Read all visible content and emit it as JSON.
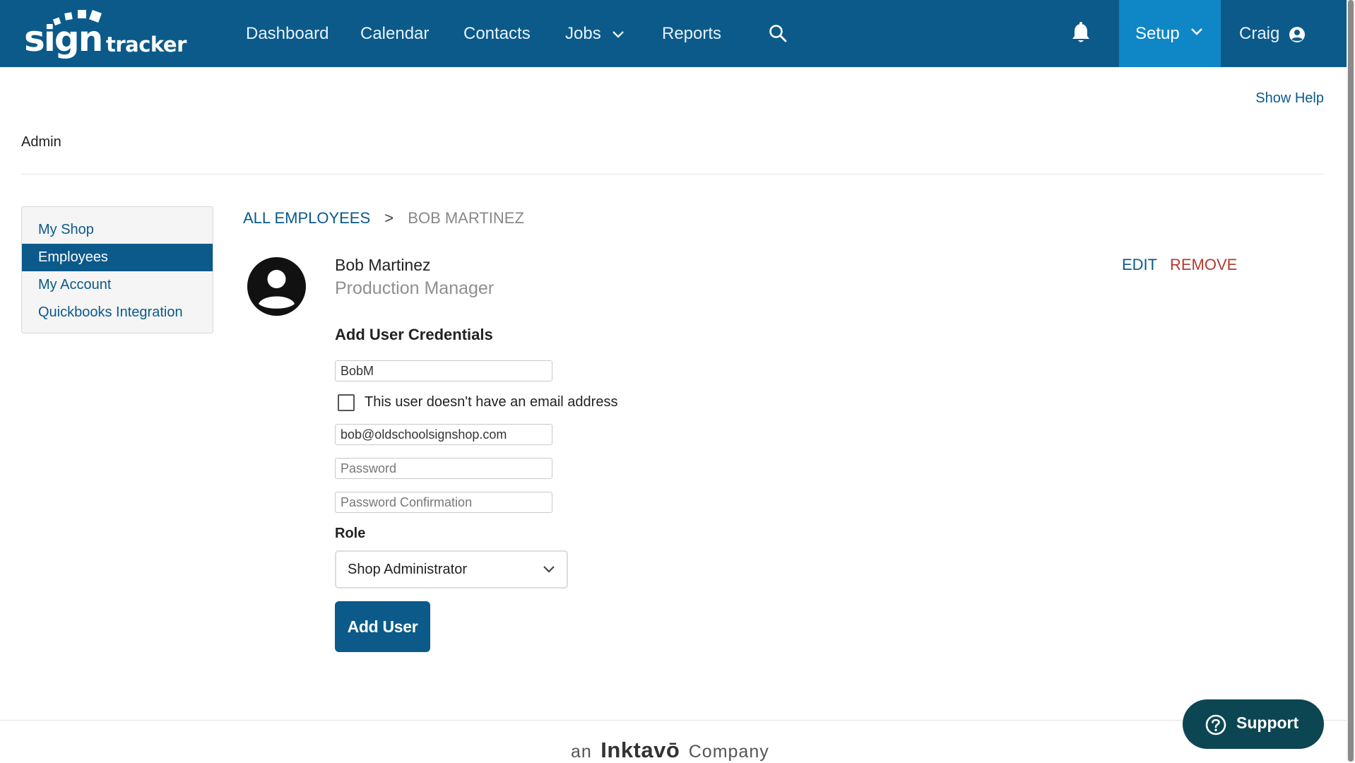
{
  "brand": {
    "logo_sign": "sign",
    "logo_tracker": "tracker",
    "logo_reg": "®"
  },
  "nav": {
    "items": [
      {
        "label": "Dashboard"
      },
      {
        "label": "Calendar"
      },
      {
        "label": "Contacts"
      },
      {
        "label": "Jobs",
        "has_dropdown": true
      },
      {
        "label": "Reports"
      }
    ],
    "search_icon": "search-icon",
    "notification_icon": "bell-icon",
    "setup_label": "Setup",
    "user_label": "Craig",
    "user_icon": "user-circle-icon"
  },
  "header": {
    "show_help": "Show Help",
    "page_title": "Admin"
  },
  "sidebar": {
    "items": [
      {
        "label": "My Shop",
        "active": false
      },
      {
        "label": "Employees",
        "active": true
      },
      {
        "label": "My Account",
        "active": false
      },
      {
        "label": "Quickbooks Integration",
        "active": false
      }
    ]
  },
  "breadcrumb": {
    "root": "ALL EMPLOYEES",
    "separator": ">",
    "current": "BOB MARTINEZ"
  },
  "employee": {
    "name": "Bob Martinez",
    "title": "Production Manager",
    "edit_label": "EDIT",
    "remove_label": "REMOVE",
    "avatar_icon": "user-circle-icon"
  },
  "credentials": {
    "heading": "Add User Credentials",
    "username_value": "BobM",
    "no_email_label": "This user doesn't have an email address",
    "no_email_checked": false,
    "email_value": "bob@oldschoolsignshop.com",
    "password_placeholder": "Password",
    "password_confirm_placeholder": "Password Confirmation",
    "role_label": "Role",
    "role_value": "Shop Administrator",
    "submit_label": "Add User"
  },
  "footer": {
    "prefix": "an",
    "company": "Inktavō",
    "suffix": "Company"
  },
  "support": {
    "label": "Support",
    "icon": "question-circle-icon"
  },
  "colors": {
    "nav_bg": "#0b5a8a",
    "nav_active_bg": "#0f87c6",
    "link": "#0b5a8a",
    "danger": "#b23a2e",
    "support_bg": "#0d4653"
  }
}
